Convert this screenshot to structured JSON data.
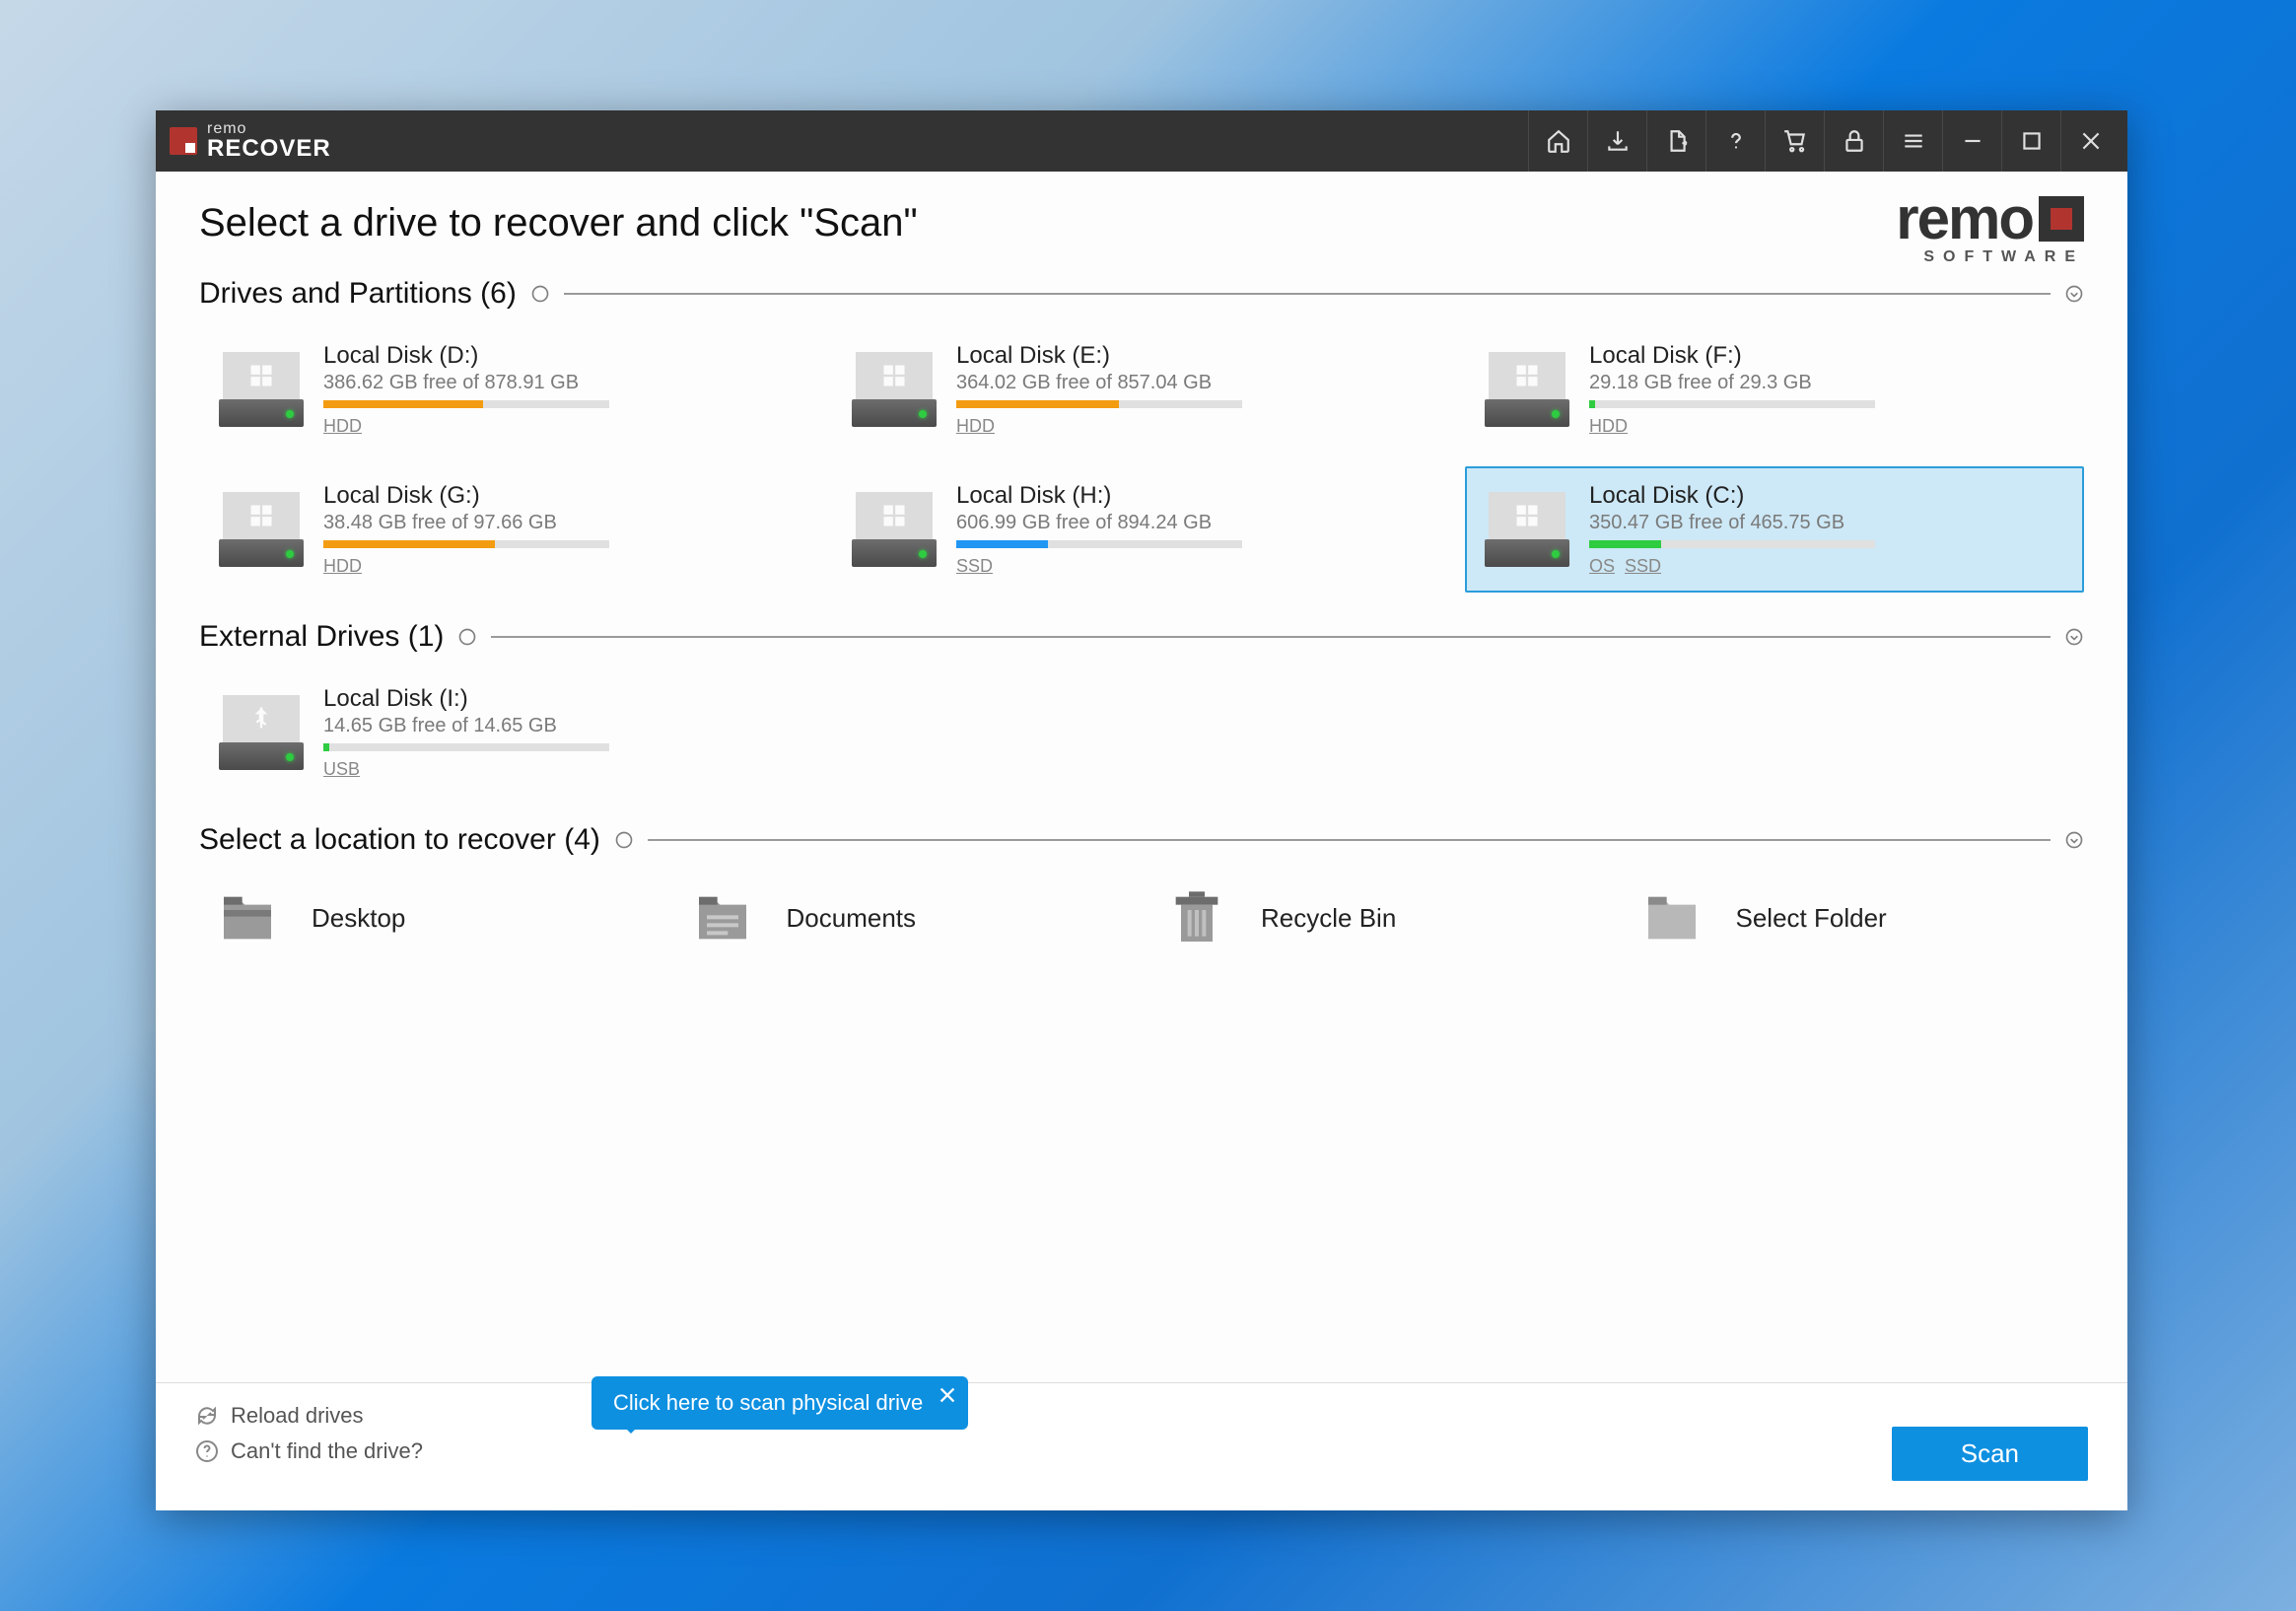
{
  "titlebar": {
    "brand_small": "remo",
    "brand_big": "RECOVER"
  },
  "brandlogo": {
    "text": "remo",
    "sub": "SOFTWARE"
  },
  "heading": "Select a drive to recover and click \"Scan\"",
  "sections": {
    "drives": {
      "title": "Drives and Partitions",
      "count": "(6)"
    },
    "external": {
      "title": "External Drives",
      "count": "(1)"
    },
    "locations": {
      "title": "Select a location to recover",
      "count": "(4)"
    }
  },
  "drives": [
    {
      "name": "Local Disk (D:)",
      "free": "386.62 GB free of 878.91 GB",
      "tags": [
        "HDD"
      ],
      "fill_pct": 56,
      "color": "#f39c12",
      "icon": "windows"
    },
    {
      "name": "Local Disk (E:)",
      "free": "364.02 GB free of 857.04 GB",
      "tags": [
        "HDD"
      ],
      "fill_pct": 57,
      "color": "#f39c12",
      "icon": "windows"
    },
    {
      "name": "Local Disk (F:)",
      "free": "29.18 GB free of 29.3 GB",
      "tags": [
        "HDD"
      ],
      "fill_pct": 2,
      "color": "#2ecc40",
      "icon": "windows"
    },
    {
      "name": "Local Disk (G:)",
      "free": "38.48 GB free of 97.66 GB",
      "tags": [
        "HDD"
      ],
      "fill_pct": 60,
      "color": "#f39c12",
      "icon": "windows"
    },
    {
      "name": "Local Disk (H:)",
      "free": "606.99 GB free of 894.24 GB",
      "tags": [
        "SSD"
      ],
      "fill_pct": 32,
      "color": "#2196f3",
      "icon": "windows"
    },
    {
      "name": "Local Disk (C:)",
      "free": "350.47 GB free of 465.75 GB",
      "tags": [
        "OS",
        "SSD"
      ],
      "fill_pct": 25,
      "color": "#2ecc40",
      "icon": "windows",
      "selected": true
    }
  ],
  "external_drives": [
    {
      "name": "Local Disk (I:)",
      "free": "14.65 GB free of 14.65 GB",
      "tags": [
        "USB"
      ],
      "fill_pct": 2,
      "color": "#2ecc40",
      "icon": "usb"
    }
  ],
  "locations": [
    {
      "label": "Desktop",
      "icon": "folder-bar"
    },
    {
      "label": "Documents",
      "icon": "folder-lines"
    },
    {
      "label": "Recycle Bin",
      "icon": "trash"
    },
    {
      "label": "Select Folder",
      "icon": "folder"
    }
  ],
  "footer": {
    "reload": "Reload drives",
    "cantfind": "Can't find the drive?",
    "scan": "Scan"
  },
  "tooltip": "Click here to scan physical drive"
}
